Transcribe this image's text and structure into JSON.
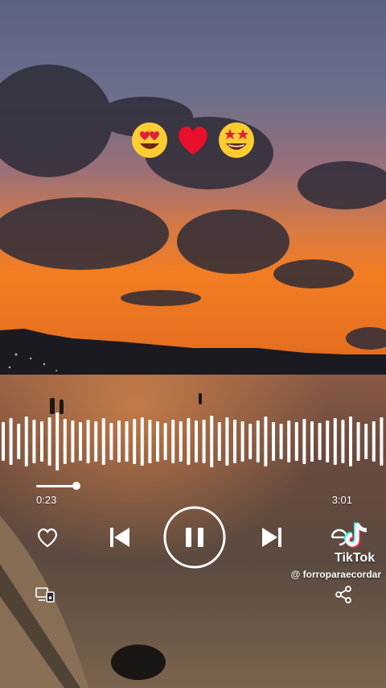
{
  "player": {
    "elapsed": "0:23",
    "total": "3:01",
    "progress_fraction": 0.127,
    "state": "playing"
  },
  "emojis": [
    "star-struck smiling face with heart eyes",
    "red heart",
    "star-struck face"
  ],
  "tiktok": {
    "brand": "TikTok",
    "handle": "@ forroparaecordar"
  },
  "icons": {
    "like": "heart-icon",
    "previous": "skip-previous-icon",
    "pause": "pause-icon",
    "next": "skip-next-icon",
    "repeat": "repeat-icon",
    "device": "device-icon",
    "share": "share-icon"
  },
  "colors": {
    "sky_top": "#5a6a88",
    "sky_mid": "#c86a55",
    "sunset": "#f07d2a",
    "water": "#6a4b3d",
    "sand": "#7a644e",
    "text": "#ffffff"
  }
}
